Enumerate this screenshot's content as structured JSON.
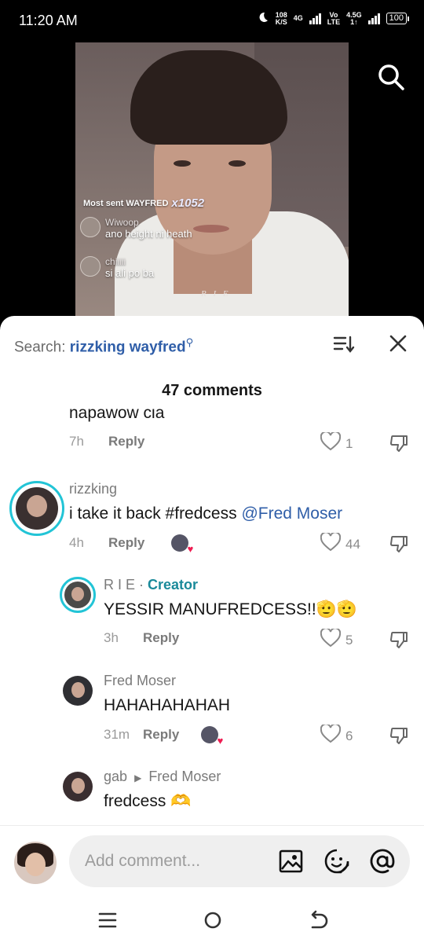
{
  "status_bar": {
    "time": "11:20 AM",
    "net_speed_value": "108",
    "net_speed_unit": "K/S",
    "network_label": "4G",
    "volte_top": "Vo",
    "volte_bottom": "LTE",
    "second_network_label": "4.5G",
    "second_network_sub": "1↑",
    "battery": "100"
  },
  "video": {
    "gift_text": "Most sent WAYFRED",
    "gift_count": "x1052",
    "live_comments": [
      {
        "name": "Wiwoop",
        "text": "ano height ni heath"
      },
      {
        "name": "chiiiii",
        "text": "si ali po ba"
      }
    ],
    "watermark": "R I E"
  },
  "sheet": {
    "search_prefix": "Search:",
    "search_query": "rizzking wayfred",
    "comments_count": "47 comments"
  },
  "comments": [
    {
      "text": "napawow cia",
      "time": "7h",
      "reply": "Reply",
      "likes": "1"
    },
    {
      "name": "rizzking",
      "text_main": "i take it back #fredcess ",
      "mention": "@Fred Moser",
      "time": "4h",
      "reply": "Reply",
      "likes": "44"
    },
    {
      "name": "R I E · ",
      "badge": "Creator",
      "text": "YESSIR MANUFREDCESS!!🫡🫡",
      "time": "3h",
      "reply": "Reply",
      "likes": "5"
    },
    {
      "name": "Fred Moser",
      "text": "HAHAHAHAHAH",
      "time": "31m",
      "reply": "Reply",
      "likes": "6"
    },
    {
      "name": "gab",
      "reply_to": "Fred Moser",
      "text": "fredcess 🫶"
    }
  ],
  "input": {
    "placeholder": "Add comment..."
  },
  "icons": {
    "heart": "heart-outline",
    "dislike": "thumbs-down-outline",
    "accent": "#22c4d6",
    "link_color": "#2f5ea8",
    "like_heart_color": "#ee1d52"
  }
}
